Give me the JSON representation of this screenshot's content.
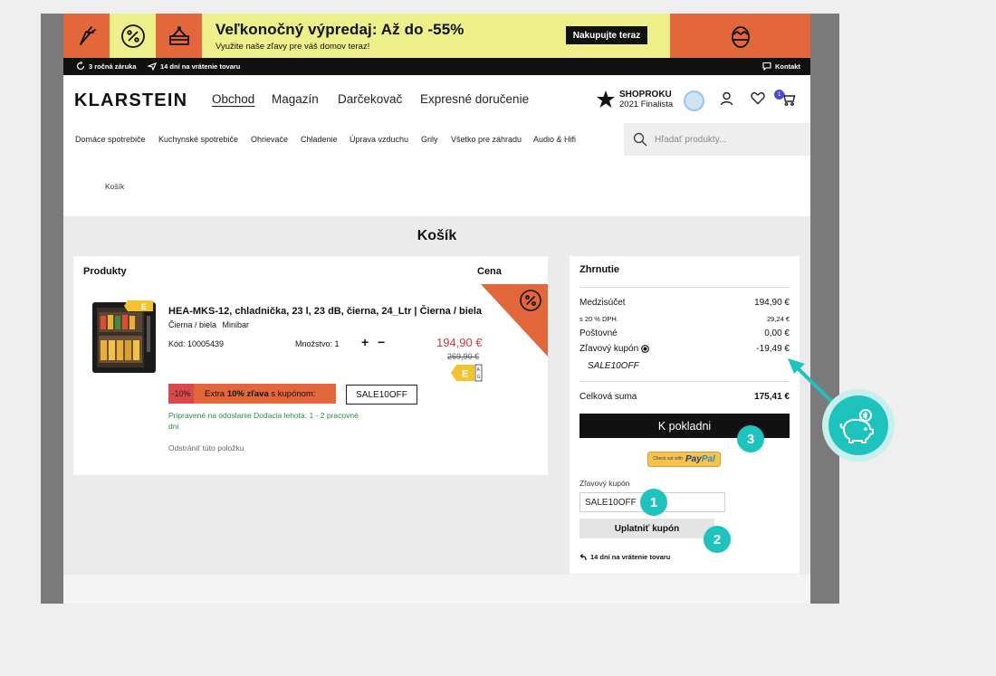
{
  "banner": {
    "title": "Veľkonočný výpredaj: Až do -55%",
    "subtitle": "Využite naše zľavy pre váš domov teraz!",
    "cta_label": "Nakupujte teraz"
  },
  "strip": {
    "warranty": "3 ročná záruka",
    "returns": "14 dní na vrátenie tovaru",
    "contact": "Kontakt"
  },
  "header": {
    "logo": "KLARSTEIN",
    "nav": [
      "Obchod",
      "Magazín",
      "Darčekovač",
      "Expresné doručenie"
    ],
    "shop_badge_title": "SHOPROKU",
    "shop_badge_sub": "2021 Finalista",
    "cart_count": "1"
  },
  "categories": [
    "Domáce spotrebiče",
    "Kuchynské spotrebiče",
    "Ohrievače",
    "Chladenie",
    "Úprava vzduchu",
    "Grily",
    "Všetko pre záhradu",
    "Audio & Hifi"
  ],
  "search": {
    "placeholder": "Hľadať produkty..."
  },
  "breadcrumb": "Košík",
  "page_title": "Košík",
  "products": {
    "col_products": "Produkty",
    "col_price": "Cena",
    "item": {
      "name": "HEA-MKS-12, chladnička, 23 l, 23 dB, čierna, 24_Ltr | Čierna / biela",
      "variant_color": "Čierna / biela",
      "variant_type": "Minibar",
      "code": "Kód: 10005439",
      "quantity": "Množstvo: 1",
      "price": "194,90 €",
      "old_price": "269,90 €",
      "energy_class": "E",
      "discount_pct": "-10%",
      "discount_pre": "Extra ",
      "discount_bold": "10% zľava",
      "discount_post": " s kupónom:",
      "coupon_code": "SALE10OFF",
      "shipping_line1": "Pripravené na odoslanie Dodacia lehota: 1 - 2 pracovné",
      "shipping_line2": "dni",
      "remove": "Odstrániť túto položku"
    }
  },
  "summary": {
    "title": "Zhrnutie",
    "subtotal_label": "Medzisúčet",
    "subtotal_value": "194,90 €",
    "vat_label": "s 20 % DPH.",
    "vat_value": "29,24 €",
    "shipping_label": "Poštovné",
    "shipping_value": "0,00 €",
    "coupon_label": "Zľavový kupón",
    "coupon_value": "-19,49 €",
    "coupon_code": "SALE10OFF",
    "total_label": "Celková suma",
    "total_value": "175,41 €",
    "checkout_label": "K pokladni",
    "paypal_small": "Check out with",
    "paypal_pay": "Pay",
    "paypal_pal": "Pal",
    "coupon_field_label": "Zľavový kupón",
    "coupon_field_value": "SALE10OFF",
    "apply_label": "Uplatniť kupón",
    "return_note": "14 dní na vrátenie tovaru"
  },
  "markers": [
    "1",
    "2",
    "3"
  ],
  "colors": {
    "accent": "#e2673b",
    "banner_bg": "#ecef8a",
    "teal": "#1fc3bd",
    "price_red": "#d0393a",
    "ship_green": "#2e8b3d"
  }
}
